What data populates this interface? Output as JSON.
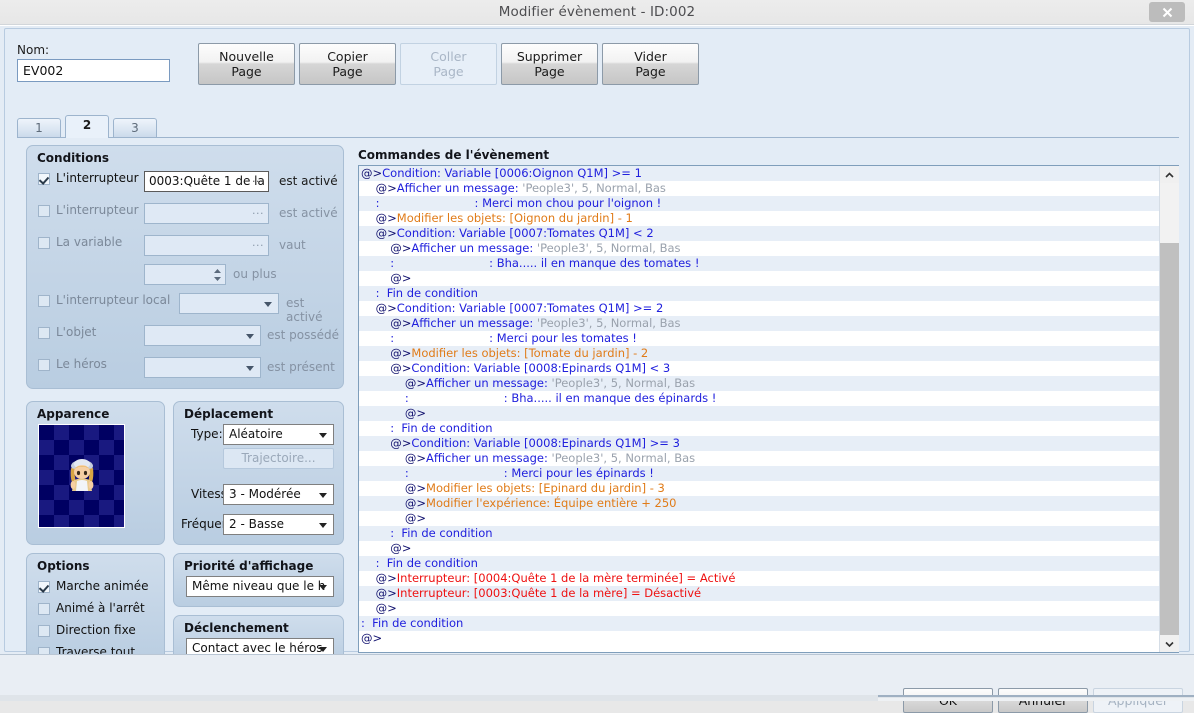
{
  "window": {
    "title": "Modifier évènement - ID:002",
    "close_icon": "close-icon"
  },
  "header": {
    "name_label": "Nom:",
    "name_value": "EV002",
    "buttons": [
      {
        "key": "nouvelle",
        "label": "Nouvelle\nPage",
        "enabled": true
      },
      {
        "key": "copier",
        "label": "Copier\nPage",
        "enabled": true
      },
      {
        "key": "coller",
        "label": "Coller\nPage",
        "enabled": false
      },
      {
        "key": "supprimer",
        "label": "Supprimer\nPage",
        "enabled": true
      },
      {
        "key": "vider",
        "label": "Vider\nPage",
        "enabled": true
      }
    ]
  },
  "tabs": {
    "items": [
      {
        "label": "1",
        "active": false
      },
      {
        "label": "2",
        "active": true
      },
      {
        "label": "3",
        "active": false
      }
    ]
  },
  "conditions": {
    "title": "Conditions",
    "rows": [
      {
        "label": "L'interrupteur",
        "checked": true,
        "field_value": "0003:Quête 1 de la ",
        "suffix": "est activé"
      },
      {
        "label": "L'interrupteur",
        "checked": false,
        "field_value": "",
        "suffix": "est activé"
      },
      {
        "label": "La variable",
        "checked": false,
        "field_value": "",
        "suffix": "vaut"
      },
      {
        "label": "L'interrupteur local",
        "checked": false,
        "field_value": "",
        "suffix": "est activé"
      },
      {
        "label": "L'objet",
        "checked": false,
        "field_value": "",
        "suffix": "est possédé"
      },
      {
        "label": "Le héros",
        "checked": false,
        "field_value": "",
        "suffix": "est présent"
      }
    ],
    "spinner_value": "",
    "spinner_suffix": "ou plus",
    "ellipsis": "···"
  },
  "apparence": {
    "title": "Apparence",
    "sprite_name": "character-sprite"
  },
  "deplacement": {
    "title": "Déplacement",
    "type_label": "Type:",
    "type_value": "Aléatoire",
    "trajectoire_label": "Trajectoire...",
    "vitesse_label": "Vitesse:",
    "vitesse_value": "3 - Modérée",
    "frequence_label": "Fréquence:",
    "frequence_value": "2 - Basse"
  },
  "options": {
    "title": "Options",
    "items": [
      {
        "label": "Marche animée",
        "checked": true
      },
      {
        "label": "Animé à l'arrêt",
        "checked": false
      },
      {
        "label": "Direction fixe",
        "checked": false
      },
      {
        "label": "Traverse tout",
        "checked": false
      }
    ]
  },
  "priorite": {
    "title": "Priorité d'affichage",
    "value": "Même niveau que le h"
  },
  "declenchement": {
    "title": "Déclenchement",
    "value": "Contact avec le héros"
  },
  "commands": {
    "title": "Commandes de l'évènement",
    "rows": [
      {
        "indent": 0,
        "tokens": [
          {
            "t": "@>",
            "c": "at"
          },
          {
            "t": "Condition: Variable [0006:Oignon Q1M] >= 1",
            "c": "blue"
          }
        ]
      },
      {
        "indent": 1,
        "tokens": [
          {
            "t": "@>",
            "c": "at"
          },
          {
            "t": "Afficher un message: ",
            "c": "blue"
          },
          {
            "t": "'People3', 5, Normal, Bas",
            "c": "gray"
          }
        ]
      },
      {
        "indent": 1,
        "tokens": [
          {
            "t": ":",
            "c": "blue"
          },
          {
            "t": "                          : Merci mon chou pour l'oignon !",
            "c": "blue"
          }
        ]
      },
      {
        "indent": 1,
        "tokens": [
          {
            "t": "@>",
            "c": "at"
          },
          {
            "t": "Modifier les objets: [Oignon du jardin] - 1",
            "c": "orange"
          }
        ]
      },
      {
        "indent": 1,
        "tokens": [
          {
            "t": "@>",
            "c": "at"
          },
          {
            "t": "Condition: Variable [0007:Tomates Q1M] < 2",
            "c": "blue"
          }
        ]
      },
      {
        "indent": 2,
        "tokens": [
          {
            "t": "@>",
            "c": "at"
          },
          {
            "t": "Afficher un message: ",
            "c": "blue"
          },
          {
            "t": "'People3', 5, Normal, Bas",
            "c": "gray"
          }
        ]
      },
      {
        "indent": 2,
        "tokens": [
          {
            "t": ":",
            "c": "blue"
          },
          {
            "t": "                          : Bha..... il en manque des tomates !",
            "c": "blue"
          }
        ]
      },
      {
        "indent": 2,
        "tokens": [
          {
            "t": "@>",
            "c": "at"
          }
        ]
      },
      {
        "indent": 1,
        "tokens": [
          {
            "t": ":",
            "c": "blue"
          },
          {
            "t": "  Fin de condition",
            "c": "blue"
          }
        ]
      },
      {
        "indent": 1,
        "tokens": [
          {
            "t": "@>",
            "c": "at"
          },
          {
            "t": "Condition: Variable [0007:Tomates Q1M] >= 2",
            "c": "blue"
          }
        ]
      },
      {
        "indent": 2,
        "tokens": [
          {
            "t": "@>",
            "c": "at"
          },
          {
            "t": "Afficher un message: ",
            "c": "blue"
          },
          {
            "t": "'People3', 5, Normal, Bas",
            "c": "gray"
          }
        ]
      },
      {
        "indent": 2,
        "tokens": [
          {
            "t": ":",
            "c": "blue"
          },
          {
            "t": "                          : Merci pour les tomates !",
            "c": "blue"
          }
        ]
      },
      {
        "indent": 2,
        "tokens": [
          {
            "t": "@>",
            "c": "at"
          },
          {
            "t": "Modifier les objets: [Tomate du jardin] - 2",
            "c": "orange"
          }
        ]
      },
      {
        "indent": 2,
        "tokens": [
          {
            "t": "@>",
            "c": "at"
          },
          {
            "t": "Condition: Variable [0008:Epinards Q1M] < 3",
            "c": "blue"
          }
        ]
      },
      {
        "indent": 3,
        "tokens": [
          {
            "t": "@>",
            "c": "at"
          },
          {
            "t": "Afficher un message: ",
            "c": "blue"
          },
          {
            "t": "'People3', 5, Normal, Bas",
            "c": "gray"
          }
        ]
      },
      {
        "indent": 3,
        "tokens": [
          {
            "t": ":",
            "c": "blue"
          },
          {
            "t": "                          : Bha..... il en manque des épinards !",
            "c": "blue"
          }
        ]
      },
      {
        "indent": 3,
        "tokens": [
          {
            "t": "@>",
            "c": "at"
          }
        ]
      },
      {
        "indent": 2,
        "tokens": [
          {
            "t": ":",
            "c": "blue"
          },
          {
            "t": "  Fin de condition",
            "c": "blue"
          }
        ]
      },
      {
        "indent": 2,
        "tokens": [
          {
            "t": "@>",
            "c": "at"
          },
          {
            "t": "Condition: Variable [0008:Epinards Q1M] >= 3",
            "c": "blue"
          }
        ]
      },
      {
        "indent": 3,
        "tokens": [
          {
            "t": "@>",
            "c": "at"
          },
          {
            "t": "Afficher un message: ",
            "c": "blue"
          },
          {
            "t": "'People3', 5, Normal, Bas",
            "c": "gray"
          }
        ]
      },
      {
        "indent": 3,
        "tokens": [
          {
            "t": ":",
            "c": "blue"
          },
          {
            "t": "                          : Merci pour les épinards !",
            "c": "blue"
          }
        ]
      },
      {
        "indent": 3,
        "tokens": [
          {
            "t": "@>",
            "c": "at"
          },
          {
            "t": "Modifier les objets: [Epinard du jardin] - 3",
            "c": "orange"
          }
        ]
      },
      {
        "indent": 3,
        "tokens": [
          {
            "t": "@>",
            "c": "at"
          },
          {
            "t": "Modifier l'expérience: Équipe entière + 250",
            "c": "orange"
          }
        ]
      },
      {
        "indent": 3,
        "tokens": [
          {
            "t": "@>",
            "c": "at"
          }
        ]
      },
      {
        "indent": 2,
        "tokens": [
          {
            "t": ":",
            "c": "blue"
          },
          {
            "t": "  Fin de condition",
            "c": "blue"
          }
        ]
      },
      {
        "indent": 2,
        "tokens": [
          {
            "t": "@>",
            "c": "at"
          }
        ]
      },
      {
        "indent": 1,
        "tokens": [
          {
            "t": ":",
            "c": "blue"
          },
          {
            "t": "  Fin de condition",
            "c": "blue"
          }
        ]
      },
      {
        "indent": 1,
        "tokens": [
          {
            "t": "@>",
            "c": "at"
          },
          {
            "t": "Interrupteur: [0004:Quête 1 de la mère terminée] = Activé",
            "c": "red"
          }
        ]
      },
      {
        "indent": 1,
        "tokens": [
          {
            "t": "@>",
            "c": "at"
          },
          {
            "t": "Interrupteur: [0003:Quête 1 de la mère] = Désactivé",
            "c": "red"
          }
        ]
      },
      {
        "indent": 1,
        "tokens": [
          {
            "t": "@>",
            "c": "at"
          }
        ]
      },
      {
        "indent": 0,
        "tokens": [
          {
            "t": ":",
            "c": "blue"
          },
          {
            "t": "  Fin de condition",
            "c": "blue"
          }
        ]
      },
      {
        "indent": 0,
        "tokens": [
          {
            "t": "@>",
            "c": "at"
          }
        ]
      }
    ]
  },
  "scrollbar": {
    "up_icon": "chevron-up-icon",
    "down_icon": "chevron-down-icon"
  },
  "footer": {
    "ok_label": "OK",
    "cancel_label": "Annuler",
    "apply_label": "Appliquer",
    "apply_enabled": false
  },
  "colors": {
    "panel": "#e3ecf6",
    "group": "#c4d4e6",
    "accent_blue": "#2020dd",
    "accent_orange": "#e07b18",
    "accent_red": "#ee1111",
    "row_alt": "#e7eef7"
  }
}
